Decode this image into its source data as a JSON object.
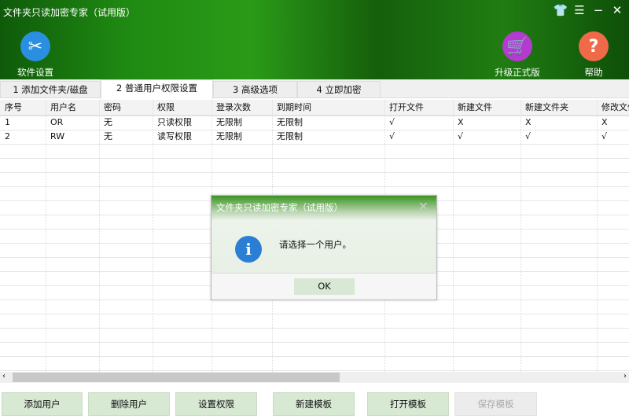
{
  "app": {
    "title": "文件夹只读加密专家（试用版）"
  },
  "toolbar": {
    "settings": "软件设置",
    "upgrade": "升级正式版",
    "help": "帮助"
  },
  "tabs": [
    "1 添加文件夹/磁盘",
    "2 普通用户权限设置",
    "3 高级选项",
    "4 立即加密"
  ],
  "table": {
    "columns": [
      "序号",
      "用户名",
      "密码",
      "权限",
      "登录次数",
      "到期时间",
      "打开文件",
      "新建文件",
      "新建文件夹",
      "修改文件"
    ],
    "rows": [
      [
        "1",
        "OR",
        "无",
        "只读权限",
        "无限制",
        "无限制",
        "√",
        "X",
        "X",
        "X"
      ],
      [
        "2",
        "RW",
        "无",
        "读写权限",
        "无限制",
        "无限制",
        "√",
        "√",
        "√",
        "√"
      ]
    ]
  },
  "buttons": [
    "添加用户",
    "删除用户",
    "设置权限",
    "新建模板",
    "打开模板",
    "保存模板"
  ],
  "dialog": {
    "title": "文件夹只读加密专家（试用版）",
    "message": "请选择一个用户。",
    "ok": "OK"
  }
}
